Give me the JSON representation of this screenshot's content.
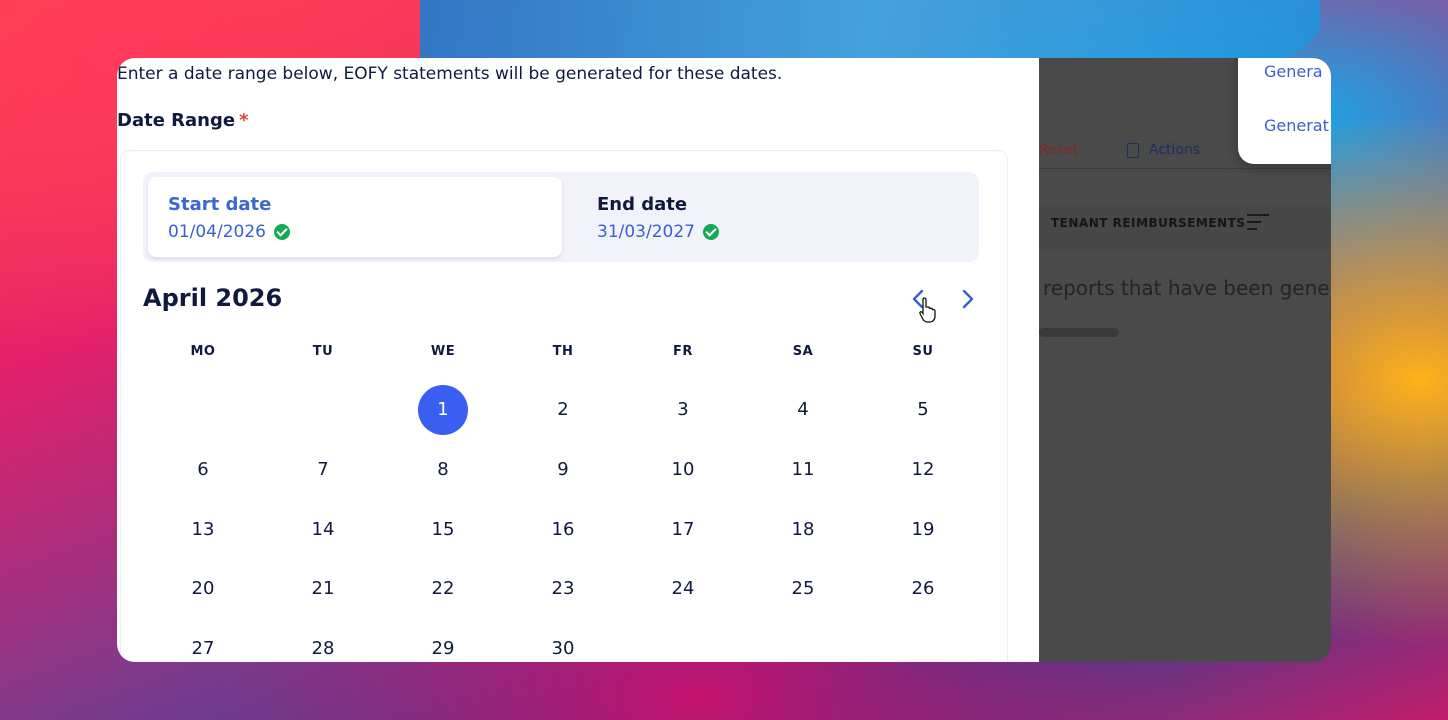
{
  "modal": {
    "intro": "Enter a date range below, EOFY statements will be generated for these dates.",
    "date_range_label": "Date Range",
    "required_mark": "*",
    "start_tab": {
      "label": "Start date",
      "value": "01/04/2026"
    },
    "end_tab": {
      "label": "End date",
      "value": "31/03/2027"
    },
    "calendar": {
      "month_title": "April 2026",
      "weekdays": [
        "MO",
        "TU",
        "WE",
        "TH",
        "FR",
        "SA",
        "SU"
      ],
      "leading_blanks": 2,
      "days": [
        "1",
        "2",
        "3",
        "4",
        "5",
        "6",
        "7",
        "8",
        "9",
        "10",
        "11",
        "12",
        "13",
        "14",
        "15",
        "16",
        "17",
        "18",
        "19",
        "20",
        "21",
        "22",
        "23",
        "24",
        "25",
        "26",
        "27",
        "28",
        "29",
        "30"
      ],
      "selected_day": "1"
    }
  },
  "background": {
    "reset_label": "Reset",
    "actions_label": "Actions",
    "tenant_column": "TENANT REIMBURSEMENTS",
    "empty_text": "reports that have been gener",
    "dropdown_items": [
      "Genera",
      "Generat"
    ]
  },
  "colors": {
    "accent": "#3a5ff0",
    "link": "#3a5fd0",
    "success": "#18a957",
    "required": "#e0413e",
    "text_dark": "#101a3c"
  }
}
